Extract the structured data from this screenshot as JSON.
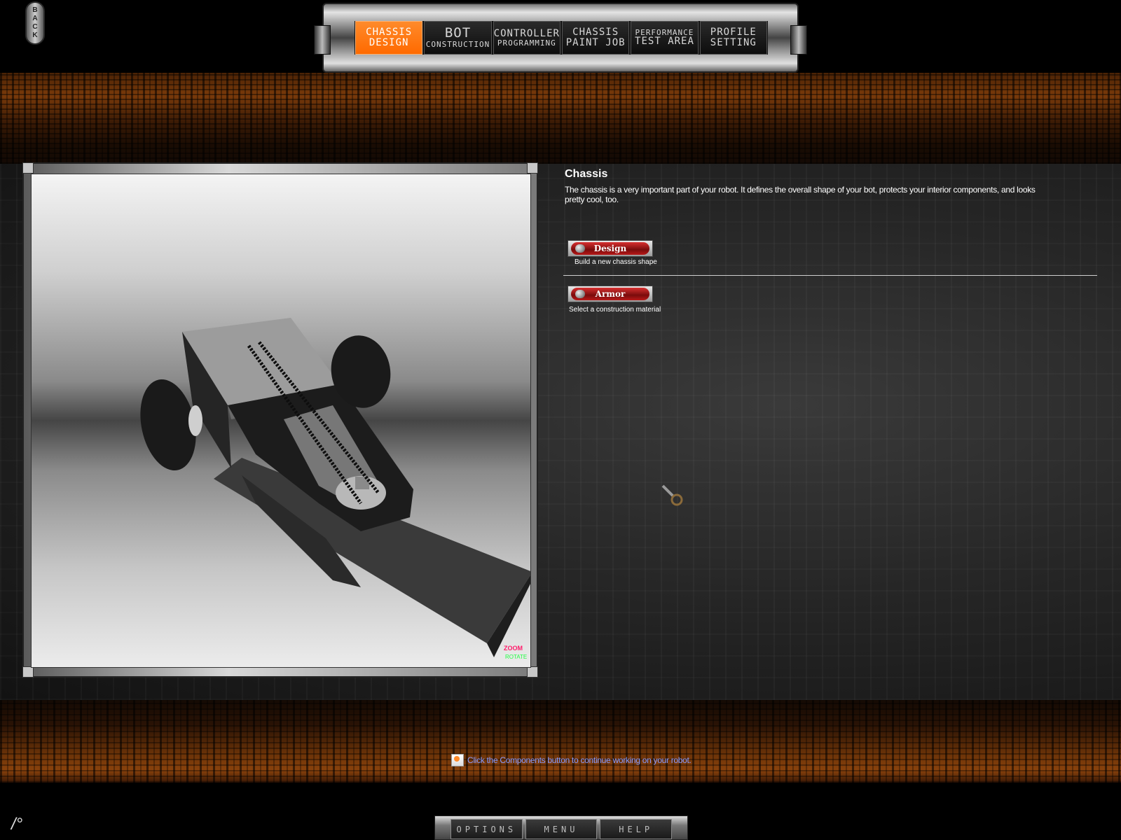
{
  "back_button": {
    "label": "BACK"
  },
  "nav": {
    "tabs": [
      {
        "line1": "CHASSIS",
        "line2": "DESIGN",
        "active": true,
        "style": "normal"
      },
      {
        "line1": "BOT",
        "line2": "CONSTRUCTION",
        "active": false,
        "style": "big-small"
      },
      {
        "line1": "CONTROLLER",
        "line2": "PROGRAMMING",
        "active": false,
        "style": "normal-small"
      },
      {
        "line1": "CHASSIS",
        "line2": "PAINT JOB",
        "active": false,
        "style": "normal"
      },
      {
        "line1": "PERFORMANCE",
        "line2": "TEST AREA",
        "active": false,
        "style": "small-normal"
      },
      {
        "line1": "PROFILE",
        "line2": "SETTING",
        "active": false,
        "style": "normal"
      }
    ]
  },
  "viewport": {
    "zoom_label": "ZOOM",
    "rotate_label": "ROTATE"
  },
  "panel": {
    "title": "Chassis",
    "description": "The chassis is a very important part of your robot. It defines the overall shape of your bot, protects your interior components, and looks pretty cool, too.",
    "actions": [
      {
        "label": "Design",
        "caption": "Build a new chassis shape"
      },
      {
        "label": "Armor",
        "caption": "Select a construction material"
      }
    ]
  },
  "hint": {
    "icon": "tips-icon",
    "text": "Click the Components button to continue working on your robot."
  },
  "bottom_menu": {
    "options": "OPTIONS",
    "menu": "MENU",
    "help": "HELP"
  },
  "colors": {
    "accent": "#ff6a00",
    "hint_text": "#8a9cff",
    "button_red": "#b81818"
  }
}
